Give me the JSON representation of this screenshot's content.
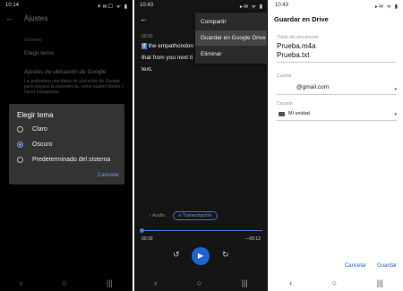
{
  "panel1": {
    "status": {
      "time": "10:14",
      "icons": "⚘✉☐ ᯤ ▮"
    },
    "header": {
      "back": "←",
      "title": "Ajustes"
    },
    "section": "General",
    "theme_item": "Elegir tema",
    "location_item": "Ajustes de ubicación de Google",
    "location_desc": "La grabadora usa datos de ubicación de Google para mejorar la experiencia, como sugerir títulos y hacer búsquedas.",
    "dialog": {
      "title": "Elegir tema",
      "options": [
        {
          "label": "Claro",
          "selected": false
        },
        {
          "label": "Oscuro",
          "selected": true
        },
        {
          "label": "Predeterminado del sistema",
          "selected": false
        }
      ],
      "cancel": "Cancelar"
    },
    "nav": {
      "back": "‹",
      "home": "○",
      "recents": "|||"
    }
  },
  "panel2": {
    "status": {
      "time": "10:43",
      "icons": "▸✉ ᯤ ▮"
    },
    "back": "←",
    "menu": [
      "Compartir",
      "Guardar en Google Drive",
      "Eliminar"
    ],
    "timestamp": "00:00",
    "transcript": {
      "cursor": "If",
      "line1": "the empathondon",
      "line2": "that from you next ti",
      "line3": "text."
    },
    "tabs": {
      "audio": "Audio",
      "transcript": "Transcripción"
    },
    "elapsed": "00:00",
    "remaining": "—00:12",
    "controls": {
      "rewind": "↺",
      "play": "▶",
      "forward": "↻"
    },
    "nav": {
      "back": "‹",
      "home": "○",
      "recents": "|||"
    }
  },
  "panel3": {
    "status": {
      "time": "10:43",
      "icons": "▸✉ ᯤ ▮"
    },
    "title": "Guardar en Drive",
    "doc_label": "Título del documento",
    "doc_values": [
      "Prueba.m4a",
      "Prueba.txt"
    ],
    "account_label": "Cuenta",
    "account_value": "@gmail.com",
    "folder_label": "Carpeta",
    "folder_value": "Mi unidad",
    "dropdown": "▾",
    "cancel": "Cancelar",
    "save": "Guardar",
    "nav": {
      "back": "‹",
      "home": "○",
      "recents": "|||"
    }
  },
  "colors": {
    "accent": "#6f9fe2",
    "play_button": "#1d63d6",
    "dialog_bg": "#333333"
  }
}
